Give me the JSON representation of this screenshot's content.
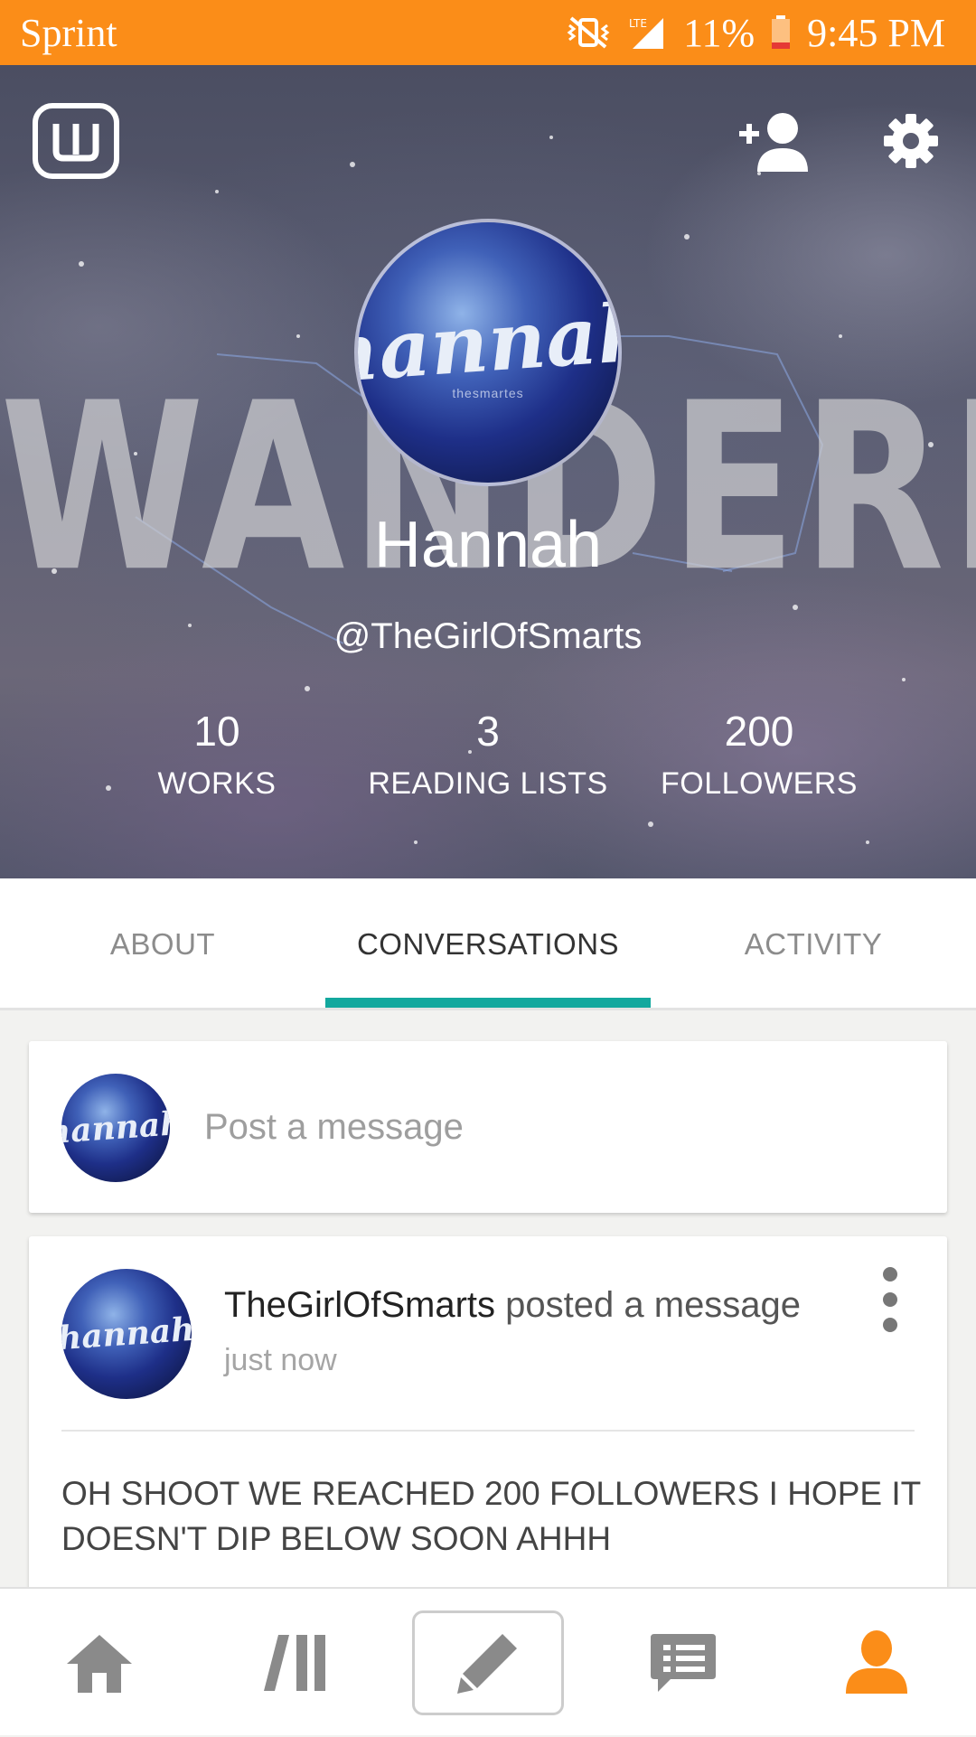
{
  "status_bar": {
    "carrier": "Sprint",
    "battery": "11%",
    "time": "9:45 PM",
    "network": "LTE"
  },
  "header": {
    "banner_text": "WANDERLUST",
    "avatar_text": "hannah",
    "avatar_subtext": "thesmartes",
    "name": "Hannah",
    "handle": "@TheGirlOfSmarts",
    "stats": [
      {
        "value": "10",
        "label": "WORKS"
      },
      {
        "value": "3",
        "label": "READING LISTS"
      },
      {
        "value": "200",
        "label": "FOLLOWERS"
      }
    ]
  },
  "tabs": [
    {
      "label": "ABOUT",
      "active": false
    },
    {
      "label": "CONVERSATIONS",
      "active": true
    },
    {
      "label": "ACTIVITY",
      "active": false
    }
  ],
  "composer": {
    "placeholder": "Post a message",
    "avatar_text": "hannah"
  },
  "message": {
    "username": "TheGirlOfSmarts",
    "action": "posted a message",
    "time": "just now",
    "body": "OH SHOOT WE REACHED 200 FOLLOWERS I HOPE IT DOESN'T DIP BELOW SOON AHHH",
    "avatar_text": "hannah"
  },
  "bottom_nav": [
    {
      "icon": "home-icon"
    },
    {
      "icon": "library-icon"
    },
    {
      "icon": "pencil-icon"
    },
    {
      "icon": "messages-icon"
    },
    {
      "icon": "profile-icon"
    }
  ],
  "colors": {
    "status_bar": "#fb8d18",
    "accent_teal": "#13a89e",
    "active_nav": "#fb8d18",
    "inactive_nav": "#8a8a8a"
  }
}
